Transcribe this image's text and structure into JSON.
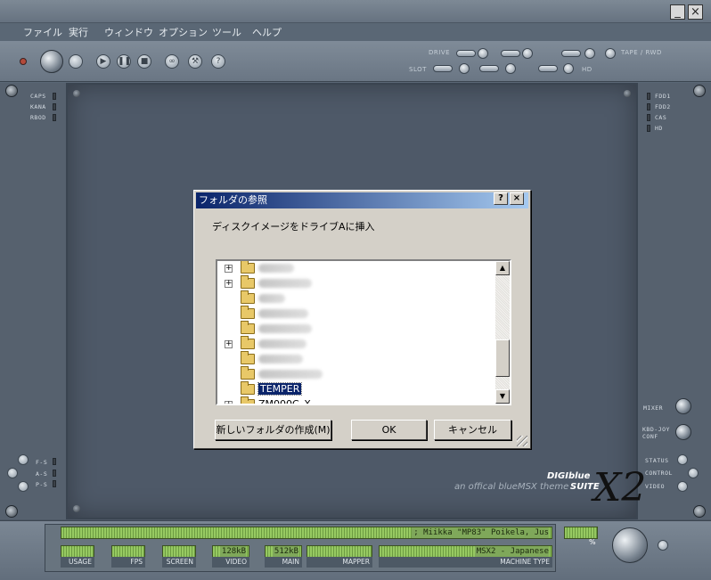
{
  "menu": [
    "ファイル",
    "実行",
    "ウィンドウ",
    "オプション",
    "ツール",
    "ヘルプ"
  ],
  "window_buttons": {
    "minimize": "_",
    "close": "×"
  },
  "control_labels": {
    "drive": "DRIVE",
    "slot": "SLOT",
    "tape": "TAPE / RWD",
    "hd": "HD"
  },
  "control_icons": [
    "power-led",
    "power-knob",
    "reset-knob",
    "play-icon",
    "pause-icon",
    "stop-icon",
    "link-icon",
    "tool-icon",
    "help-icon"
  ],
  "left_leds": [
    "CAPS",
    "KANA",
    "RBOD"
  ],
  "right_leds": [
    "FDD1",
    "FDD2",
    "CAS",
    "HD"
  ],
  "left_bottom_leds": [
    "F-S",
    "A-S",
    "P-S"
  ],
  "right_buttons": [
    "MIXER",
    "KBD-JOY CONF"
  ],
  "right_status": [
    "STATUS",
    "CONTROL",
    "VIDEO"
  ],
  "brand": {
    "line1": "DIGIblue",
    "line2": "SUITE",
    "tagline": "an offical blueMSX theme",
    "logo": "X2"
  },
  "dialog": {
    "title": "フォルダの参照",
    "help_btn": "?",
    "close_btn": "×",
    "message": "ディスクイメージをドライブAに挿入",
    "tree": [
      {
        "expandable": true,
        "label": ""
      },
      {
        "expandable": true,
        "label": ""
      },
      {
        "expandable": false,
        "label": ""
      },
      {
        "expandable": false,
        "label": ""
      },
      {
        "expandable": false,
        "label": ""
      },
      {
        "expandable": true,
        "label": ""
      },
      {
        "expandable": false,
        "label": ""
      },
      {
        "expandable": false,
        "label": ""
      },
      {
        "expandable": false,
        "label": "TEMPER",
        "selected": true
      },
      {
        "expandable": true,
        "label": "ZM000C_X"
      }
    ],
    "buttons": {
      "new_folder": "新しいフォルダの作成(M)",
      "ok": "OK",
      "cancel": "キャンセル"
    }
  },
  "status": {
    "ticker": "; Miikka \"MP83\" Poikela, Jus",
    "percent_label": "%",
    "video_value": "128kB",
    "main_value": "512kB",
    "machine_value": "MSX2 - Japanese",
    "labels": [
      "USAGE",
      "FPS",
      "SCREEN",
      "VIDEO",
      "MAIN",
      "MAPPER",
      "MACHINE TYPE"
    ]
  }
}
